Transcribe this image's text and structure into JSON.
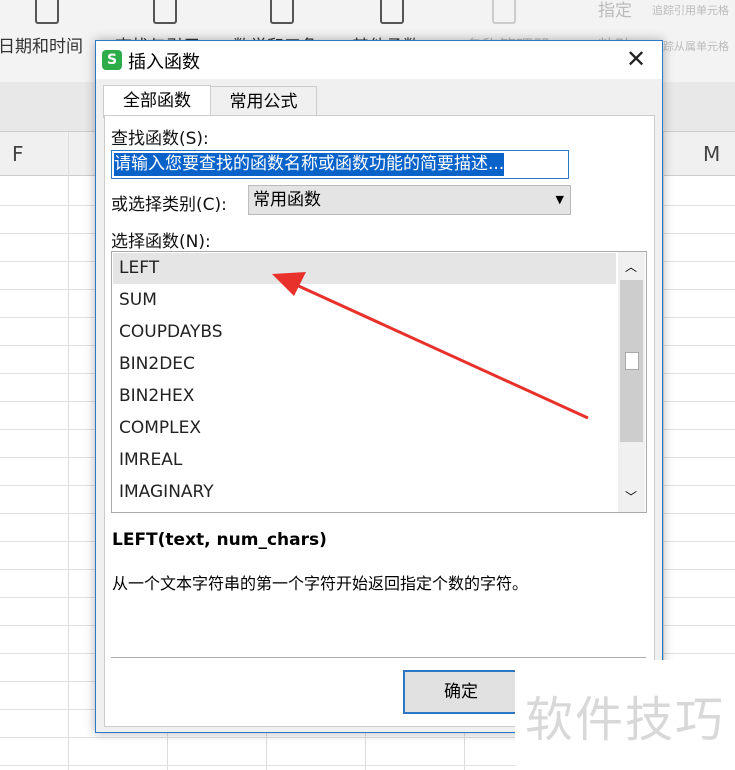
{
  "ribbon": {
    "items": [
      {
        "label": "日期和时间",
        "icon": "calendar-clock-icon"
      },
      {
        "label": "查找与引用",
        "icon": "book-search-icon"
      },
      {
        "label": "数学和三角",
        "icon": "book-plus-minus-icon"
      },
      {
        "label": "其他函数",
        "icon": "book-more-icon"
      },
      {
        "label": "名称管理器",
        "icon": "name-manager-icon"
      },
      {
        "label": "指定"
      },
      {
        "label": "粘贴"
      },
      {
        "label": "追踪引用单元格"
      },
      {
        "label": "追踪从属单元格"
      }
    ]
  },
  "sheet": {
    "columns": [
      "F",
      "M"
    ]
  },
  "dialog": {
    "title": "插入函数",
    "tabs": [
      "全部函数",
      "常用公式"
    ],
    "active_tab": 0,
    "search_label": "查找函数(S):",
    "search_value": "请输入您要查找的函数名称或函数功能的简要描述...",
    "category_label": "或选择类别(C):",
    "category_value": "常用函数",
    "function_label": "选择函数(N):",
    "functions": [
      "LEFT",
      "SUM",
      "COUPDAYBS",
      "BIN2DEC",
      "BIN2HEX",
      "COMPLEX",
      "IMREAL",
      "IMAGINARY"
    ],
    "selected_function": "LEFT",
    "signature": "LEFT(text, num_chars)",
    "description": "从一个文本字符串的第一个字符开始返回指定个数的字符。",
    "ok_label": "确定"
  },
  "watermark": "软件技巧",
  "colors": {
    "accent": "#2b78c5",
    "selection": "#0a63c9",
    "arrow": "#e8312a",
    "app_icon": "#2dac4a"
  }
}
